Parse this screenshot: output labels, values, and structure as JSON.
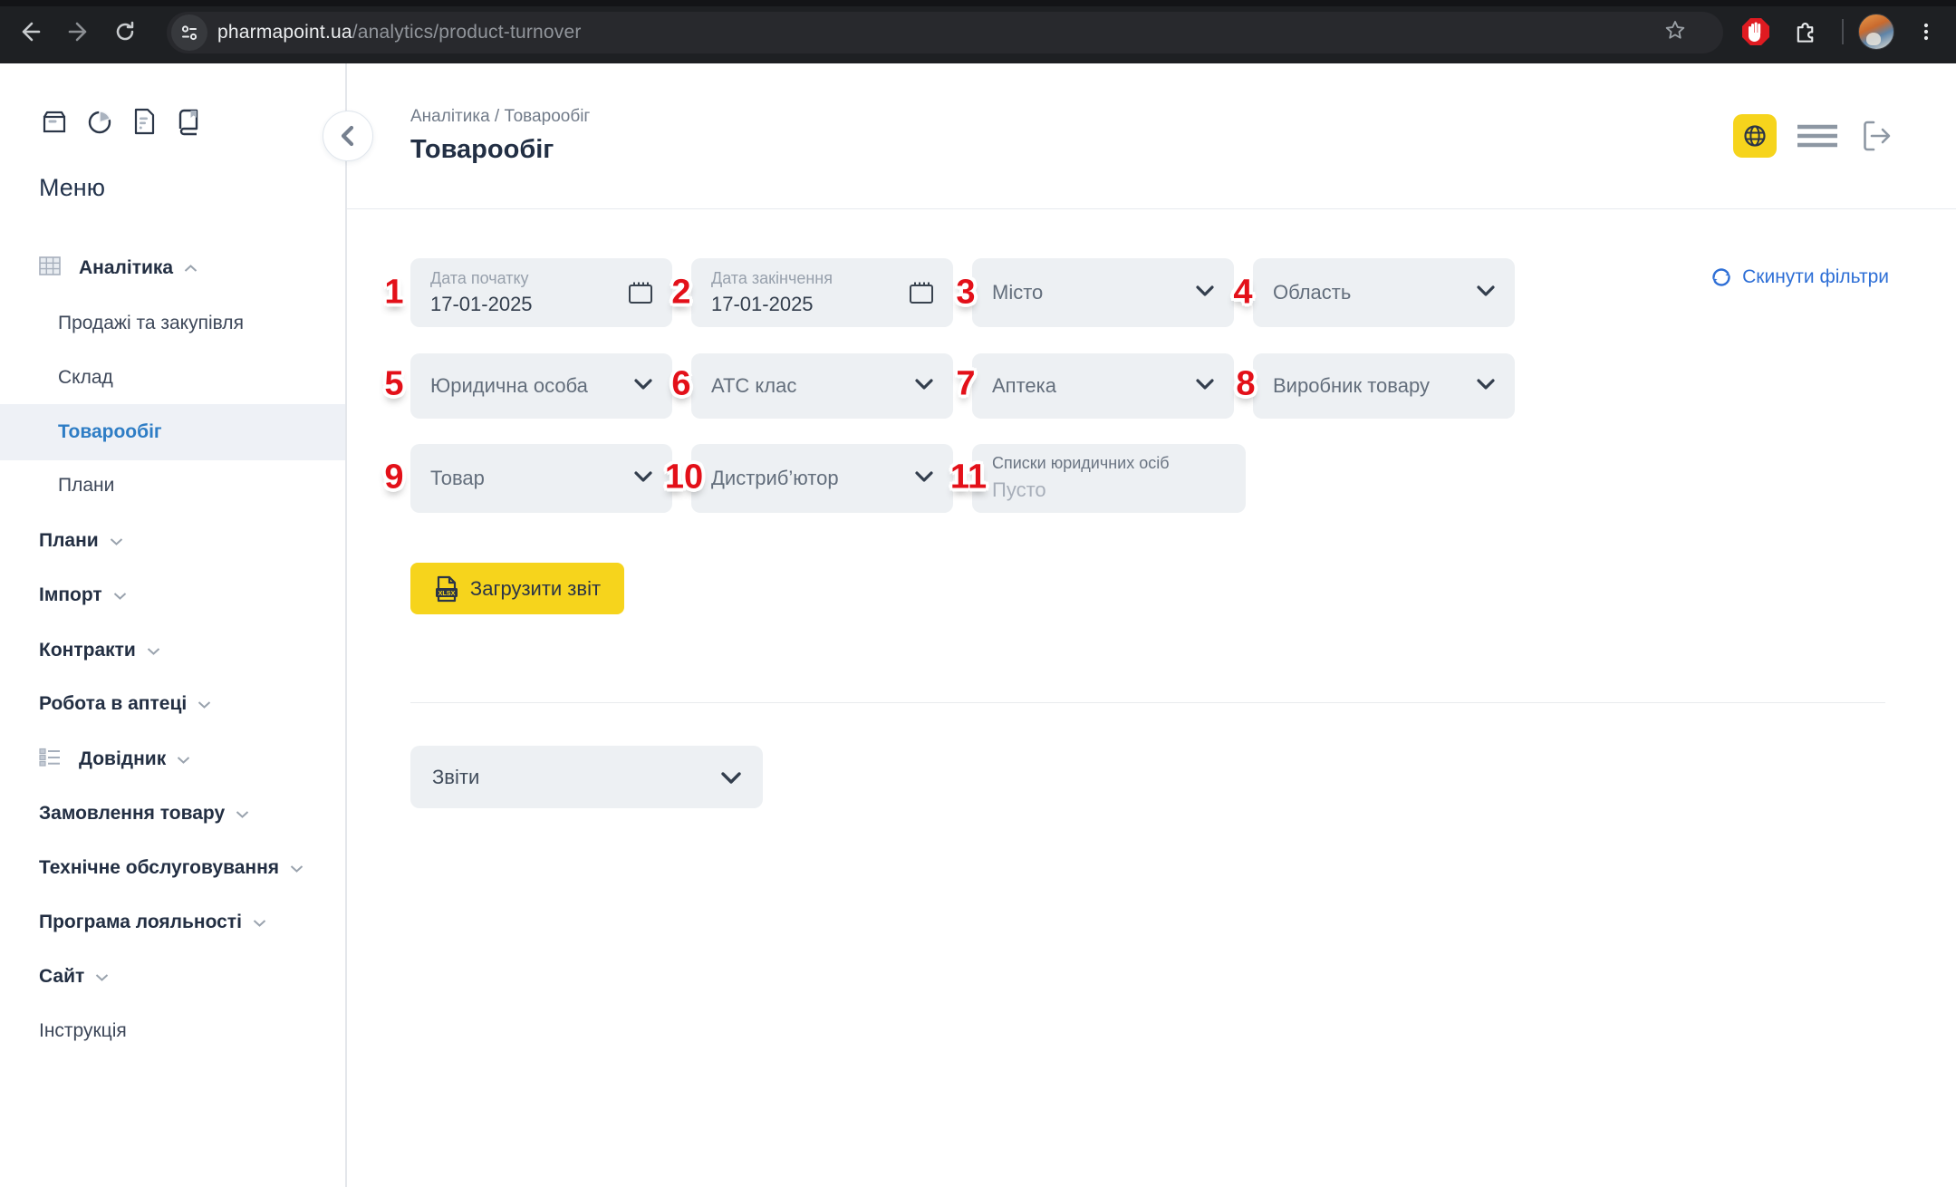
{
  "browser": {
    "url_domain": "pharmapoint.ua",
    "url_path": "/analytics/product-turnover"
  },
  "sidebar": {
    "menu_title": "Меню",
    "items": [
      {
        "label": "Аналітика",
        "expanded": true
      },
      {
        "label": "Продажі та закупівля"
      },
      {
        "label": "Склад"
      },
      {
        "label": "Товарообіг",
        "active": true
      },
      {
        "label": "Плани"
      },
      {
        "label": "Плани"
      },
      {
        "label": "Імпорт"
      },
      {
        "label": "Контракти"
      },
      {
        "label": "Робота в аптеці"
      },
      {
        "label": "Довідник"
      },
      {
        "label": "Замовлення товару"
      },
      {
        "label": "Технічне обслуговування"
      },
      {
        "label": "Програма лояльності"
      },
      {
        "label": "Сайт"
      },
      {
        "label": "Інструкція"
      }
    ],
    "top_icons": [
      "box-icon",
      "pie-chart-icon",
      "document-icon",
      "book-icon"
    ]
  },
  "header": {
    "breadcrumb": "Аналітика / Товарообіг",
    "title": "Товарообіг",
    "icons": [
      "globe-icon",
      "menu-lines-icon",
      "logout-icon"
    ]
  },
  "filters": {
    "reset_label": "Скинути фільтри",
    "start_date": {
      "label": "Дата початку",
      "value": "17-01-2025"
    },
    "end_date": {
      "label": "Дата закінчення",
      "value": "17-01-2025"
    },
    "city": {
      "label": "Місто"
    },
    "region": {
      "label": "Область"
    },
    "legal_entity": {
      "label": "Юридична особа"
    },
    "atc_class": {
      "label": "АТС клас"
    },
    "pharmacy": {
      "label": "Аптека"
    },
    "manufacturer": {
      "label": "Виробник товару"
    },
    "product": {
      "label": "Товар"
    },
    "distributor": {
      "label": "Дистриб’ютор"
    },
    "legal_lists": {
      "label": "Списки юридичних осіб",
      "value": "Пусто"
    }
  },
  "annotations": [
    "1",
    "2",
    "3",
    "4",
    "5",
    "6",
    "7",
    "8",
    "9",
    "10",
    "11"
  ],
  "actions": {
    "download_report": "Загрузити звіт",
    "reports_dropdown": "Звіти"
  },
  "colors": {
    "accent_yellow": "#F6D41C",
    "link_blue": "#2E6FD6",
    "active_blue": "#2E7DC5",
    "annotation_red": "#E31019",
    "chip_gray": "#EDF0F3",
    "browser_dark": "#1E2023"
  }
}
